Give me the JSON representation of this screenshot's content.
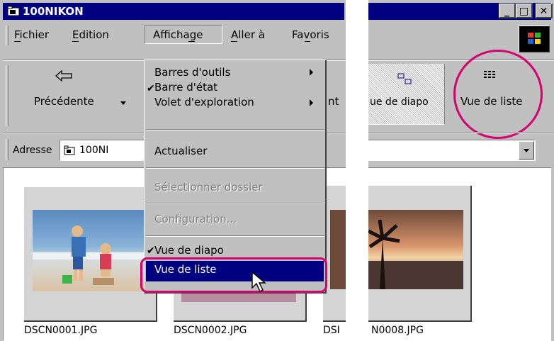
{
  "window": {
    "title": "100NIKON"
  },
  "menubar": {
    "items": [
      "Fichier",
      "Edition",
      "Affichage",
      "Aller à",
      "Favoris"
    ]
  },
  "toolbar": {
    "back_label": "Précédente",
    "partial_label": "nt",
    "slideshow_view_label": "ue de diapo",
    "list_view_label": "Vue de liste"
  },
  "address": {
    "label": "Adresse",
    "value": "100NI"
  },
  "menu": {
    "items": [
      {
        "label": "Barres d'outils",
        "submenu": true
      },
      {
        "label": "Barre d'état",
        "checked": true
      },
      {
        "label": "Volet d'exploration",
        "submenu": true
      },
      {
        "label": "Actualiser"
      },
      {
        "label": "Sélectionner dossier",
        "disabled": true
      },
      {
        "label": "Configuration...",
        "disabled": true
      },
      {
        "label": "Vue de diapo",
        "checked": true
      },
      {
        "label": "Vue de liste",
        "highlighted": true
      }
    ]
  },
  "files": [
    {
      "name": "DSCN0001.JPG"
    },
    {
      "name": "DSCN0002.JPG"
    },
    {
      "name": "DSI"
    },
    {
      "name": "N0008.JPG"
    }
  ],
  "colors": {
    "titlebar": "#000080",
    "highlight": "#000080",
    "annotation": "#d6006e"
  }
}
